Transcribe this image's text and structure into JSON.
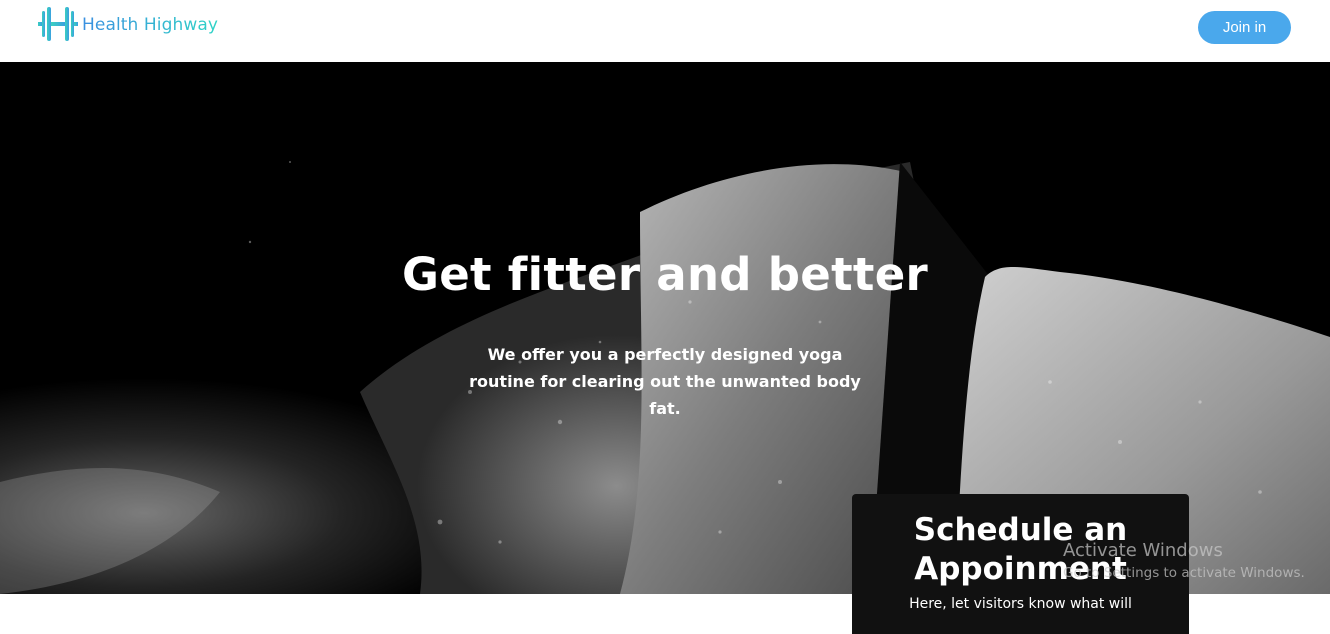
{
  "header": {
    "brand_name": "Health Highway",
    "logo_icon": "barbell-h-logo-icon",
    "join_label": "Join in",
    "colors": {
      "brand_gradient_start": "#3a8fe0",
      "brand_gradient_end": "#2fd3c6",
      "button": "#4aa8ec"
    }
  },
  "hero": {
    "title": "Get fitter and better",
    "subtitle": "We offer you a perfectly designed yoga routine for clearing out the unwanted body fat.",
    "background": "black-and-white close-up photo"
  },
  "schedule": {
    "title": "Schedule an Appoinment",
    "description": "Here, let visitors know what will"
  },
  "os_watermark": {
    "title": "Activate Windows",
    "subtitle": "Go to Settings to activate Windows."
  }
}
